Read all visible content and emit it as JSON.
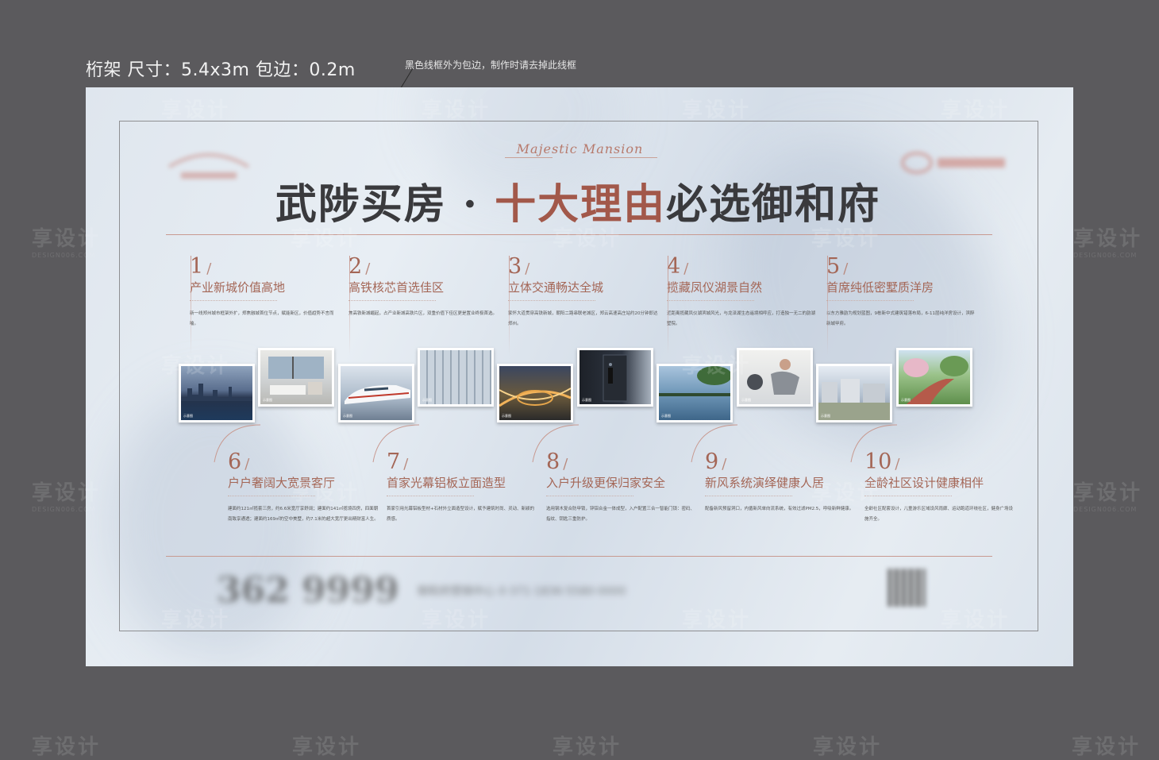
{
  "spec": {
    "title": "桁架 尺寸：5.4x3m   包边：0.2m",
    "note": "黑色线框外为包边，制作时请去掉此线框"
  },
  "brand": {
    "script": "Majestic Mansion"
  },
  "headline": {
    "part1": "武陟买房 · ",
    "highlight": "十大理由",
    "part2": "必选御和府"
  },
  "reasons_top": [
    {
      "num": "1",
      "title": "产业新城价值高地",
      "desc": "新一线郑州城市框架外扩，郑焦融城首位节点，赋能新区，价值趋势不言而喻。"
    },
    {
      "num": "2",
      "title": "高铁核芯首选佳区",
      "desc": "焦高铁新城崛起，占产业新城高铁片区，双重价值下佳区更是置业终极首选。"
    },
    {
      "num": "3",
      "title": "立体交通畅达全城",
      "desc": "家怀大道贯穿高铁新城，朝阳二路串联老城区，郑云高速高庄站约20分钟即达郑州。"
    },
    {
      "num": "4",
      "title": "揽藏凤仪湖景自然",
      "desc": "近距离揽藏凤仪湖滨城风光，与龙泽湖生态遥境相呼应，打造独一无二的韵湖墅院。"
    },
    {
      "num": "5",
      "title": "首席纯低密墅质洋房",
      "desc": "以东方雅韵为规划蓝图，9栋新中式建筑错落布局，6-11层纯洋房设计，滨醉新城甲府。"
    }
  ],
  "reasons_bottom": [
    {
      "num": "6",
      "title": "户户奢阔大宽景客厅",
      "desc": "建面约121㎡揽套三房，约6.6米宽厅享舒阔；建面约141㎡揽境四房，四面朝南致享通透；建面约169㎡的空中美墅，约7.1米的超大宽厅更出精财富人生。"
    },
    {
      "num": "7",
      "title": "首家光幕铝板立面造型",
      "desc": "首家引用光幕铝板型材+石材外立面造型设计，赋予建筑时尚、灵动、新颖的质感。"
    },
    {
      "num": "8",
      "title": "入户升级更保归家安全",
      "desc": "选用钢木复合防甲锁，锌铝合金一体成型，入户配置三合一智能门锁：密码、指纹、钥匙三重防护。"
    },
    {
      "num": "9",
      "title": "新风系统演绎健康人居",
      "desc": "配备新风预留洞口，内循新风单向流系统，有效过滤PM2.5，呼吸新鲜健康。"
    },
    {
      "num": "10",
      "title": "全龄社区设计健康相伴",
      "desc": "全龄社区配套设计，儿童游乐区域设风雨廊、运动跑道环绕社区，健身广场设施齐全。"
    }
  ],
  "photo_caption": "示意图",
  "contact": {
    "hotline": "362 9999",
    "label": "御和府营销中心  0·371·1836·5580·0000"
  },
  "watermark": {
    "text": "享设计",
    "sub": "DESIGN006.COM"
  }
}
